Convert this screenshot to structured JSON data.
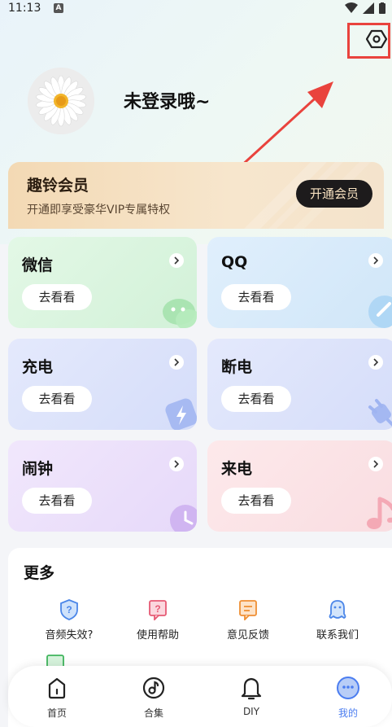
{
  "status_bar": {
    "time": "11:13",
    "notif_badge": "A"
  },
  "user": {
    "name": "未登录哦~"
  },
  "vip": {
    "title": "趣铃会员",
    "desc": "开通即享受豪华VIP专属特权",
    "button": "开通会员"
  },
  "cards": [
    {
      "title": "微信",
      "button": "去看看",
      "icon": "wechat-icon",
      "bg": "#d9f5dd"
    },
    {
      "title": "QQ",
      "button": "去看看",
      "icon": "qq-icon",
      "bg": "#d9ecfa"
    },
    {
      "title": "充电",
      "button": "去看看",
      "icon": "charging-icon",
      "bg": "#dde4fb"
    },
    {
      "title": "断电",
      "button": "去看看",
      "icon": "plug-icon",
      "bg": "#dde4fb"
    },
    {
      "title": "闹钟",
      "button": "去看看",
      "icon": "alarm-icon",
      "bg": "#ede2fb"
    },
    {
      "title": "来电",
      "button": "去看看",
      "icon": "music-icon",
      "bg": "#fbe3e6"
    }
  ],
  "more": {
    "title": "更多",
    "items": [
      {
        "label": "音频失效?",
        "icon": "audio-invalid-icon"
      },
      {
        "label": "使用帮助",
        "icon": "help-icon"
      },
      {
        "label": "意见反馈",
        "icon": "feedback-icon"
      },
      {
        "label": "联系我们",
        "icon": "contact-icon"
      }
    ]
  },
  "nav": [
    {
      "label": "首页",
      "icon": "home-icon",
      "active": false
    },
    {
      "label": "合集",
      "icon": "collection-icon",
      "active": false
    },
    {
      "label": "DIY",
      "icon": "bell-icon",
      "active": false
    },
    {
      "label": "我的",
      "icon": "profile-icon",
      "active": true
    }
  ],
  "colors": {
    "accent": "#4b7df0",
    "highlight": "#e9433d",
    "vip_button": "#1d1b1c"
  }
}
